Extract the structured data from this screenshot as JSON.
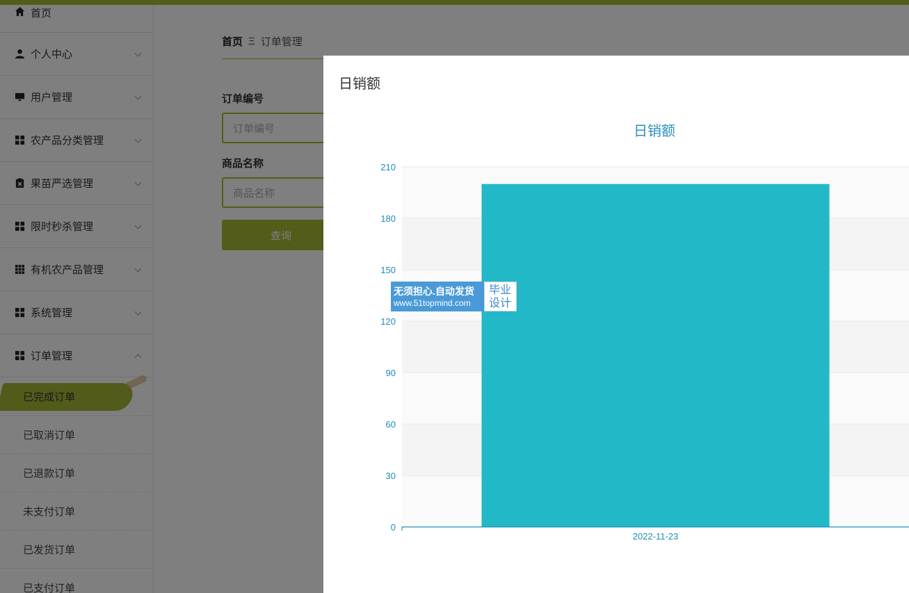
{
  "sidebar": {
    "top_item": "首页",
    "items": [
      {
        "label": "个人中心",
        "icon": "person-icon"
      },
      {
        "label": "用户管理",
        "icon": "monitor-icon"
      },
      {
        "label": "农产品分类管理",
        "icon": "grid-icon"
      },
      {
        "label": "果苗严选管理",
        "icon": "clipboard-icon"
      },
      {
        "label": "限时秒杀管理",
        "icon": "grid-icon"
      },
      {
        "label": "有机农产品管理",
        "icon": "apps-icon"
      },
      {
        "label": "系统管理",
        "icon": "grid-icon"
      },
      {
        "label": "订单管理",
        "icon": "grid-icon"
      }
    ],
    "sub_items": [
      "已完成订单",
      "已取消订单",
      "已退款订单",
      "未支付订单",
      "已发货订单",
      "已支付订单"
    ]
  },
  "breadcrumb": {
    "home": "首页",
    "separator": "Ξ",
    "current": "订单管理"
  },
  "search_form": {
    "order_no_label": "订单编号",
    "order_no_placeholder": "订单编号",
    "product_name_label": "商品名称",
    "product_name_placeholder": "商品名称",
    "query_button": "查询"
  },
  "modal": {
    "title": "日销额"
  },
  "chart_data": {
    "type": "bar",
    "title": "日销额",
    "categories": [
      "2022-11-23"
    ],
    "values": [
      200
    ],
    "ylim": [
      0,
      210
    ],
    "yticks": [
      0,
      30,
      60,
      90,
      120,
      150,
      180,
      210
    ],
    "grid": true,
    "bar_color": "#22b8c8",
    "axis_color": "#1a8fb4"
  },
  "watermark": {
    "line1": "无须担心.自动发货",
    "line2": "www.51topmind.com",
    "right1": "毕业",
    "right2": "设计"
  },
  "colors": {
    "accent": "#a8b832",
    "bar": "#22b8c8"
  }
}
